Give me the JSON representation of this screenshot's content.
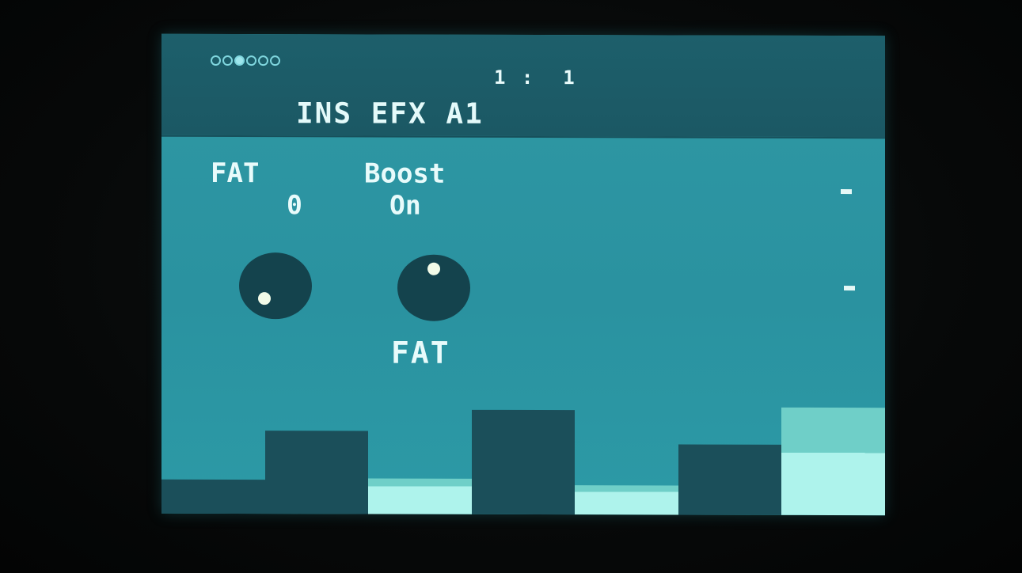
{
  "header": {
    "page_indicator": {
      "count": 6,
      "active_index": 2
    },
    "position": "1 :  1",
    "title": "INS EFX A1"
  },
  "params": [
    {
      "label": "FAT",
      "value": "0"
    },
    {
      "label": "Boost",
      "value": "On"
    }
  ],
  "knobs": [
    {
      "name": "fat-knob",
      "level": 0.15
    },
    {
      "name": "boost-knob",
      "level": 0.55
    }
  ],
  "focus_label": "FAT",
  "level_bars": [
    {
      "dark": 0.21,
      "light": 0.0
    },
    {
      "dark": 0.51,
      "light": 0.0
    },
    {
      "dark": 0.0,
      "light": 0.22
    },
    {
      "dark": 0.64,
      "light": 0.0
    },
    {
      "dark": 0.0,
      "light": 0.18
    },
    {
      "dark": 0.43,
      "light": 0.0
    },
    {
      "dark": 0.0,
      "light": 0.66
    }
  ],
  "colors": {
    "screen": "#2c96a2",
    "header": "#1c5b67",
    "knob": "#14434d",
    "bar_dark": "#1b4f5a",
    "bar_light": "#aef3ec"
  }
}
